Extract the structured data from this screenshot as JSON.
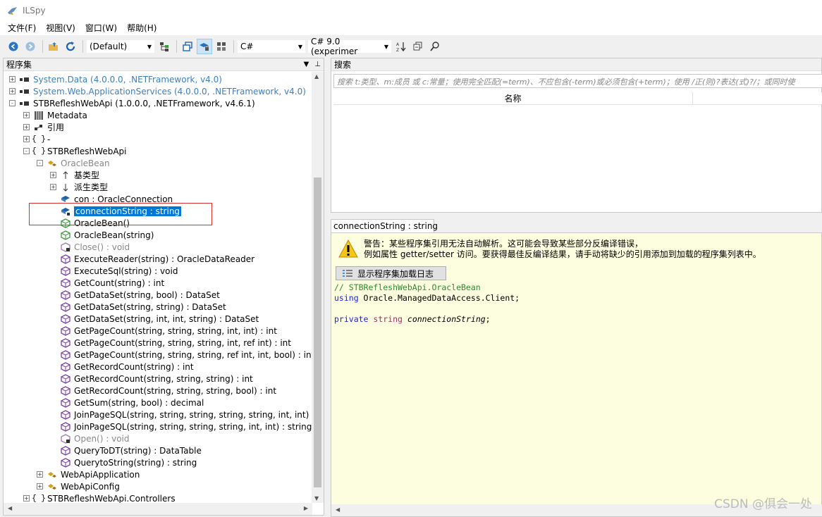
{
  "window": {
    "title": "ILSpy"
  },
  "menu": [
    "文件(F)",
    "视图(V)",
    "窗口(W)",
    "帮助(H)"
  ],
  "toolbar": {
    "assembly_list": "(Default)",
    "language": "C#",
    "language_version": "C# 9.0 (experimer"
  },
  "assembly_panel": {
    "title": "程序集"
  },
  "tree": [
    {
      "label": "System.Data (4.0.0.0, .NETFramework, v4.0)",
      "style": "blue",
      "indent": 0,
      "expander": "+",
      "icon": "assembly-icon"
    },
    {
      "label": "System.Web.ApplicationServices (4.0.0.0, .NETFramework, v4.0)",
      "style": "blue",
      "indent": 0,
      "expander": "+",
      "icon": "assembly-icon"
    },
    {
      "label": "STBRefleshWebApi (1.0.0.0, .NETFramework, v4.6.1)",
      "style": "normal",
      "indent": 0,
      "expander": "-",
      "icon": "assembly-icon"
    },
    {
      "label": "Metadata",
      "style": "normal",
      "indent": 1,
      "expander": "+",
      "icon": "metadata-icon"
    },
    {
      "label": "引用",
      "style": "normal",
      "indent": 1,
      "expander": "+",
      "icon": "references-icon"
    },
    {
      "label": "-",
      "style": "normal",
      "indent": 1,
      "expander": "+",
      "icon": "namespace-icon"
    },
    {
      "label": "STBRefleshWebApi",
      "style": "normal",
      "indent": 1,
      "expander": "-",
      "icon": "namespace-icon"
    },
    {
      "label": "OracleBean",
      "style": "gray",
      "indent": 2,
      "expander": "-",
      "icon": "class-icon"
    },
    {
      "label": "基类型",
      "style": "normal",
      "indent": 3,
      "expander": "+",
      "icon": "base-types-icon"
    },
    {
      "label": "派生类型",
      "style": "normal",
      "indent": 3,
      "expander": "+",
      "icon": "derived-types-icon"
    },
    {
      "label": "con : OracleConnection",
      "style": "normal",
      "indent": 3,
      "expander": "",
      "icon": "field-icon"
    },
    {
      "label": "connectionString : string",
      "style": "selected",
      "indent": 3,
      "expander": "",
      "icon": "field-private-icon"
    },
    {
      "label": "OracleBean()",
      "style": "normal",
      "indent": 3,
      "expander": "",
      "icon": "constructor-icon"
    },
    {
      "label": "OracleBean(string)",
      "style": "normal",
      "indent": 3,
      "expander": "",
      "icon": "constructor-icon"
    },
    {
      "label": "Close() : void",
      "style": "gray",
      "indent": 3,
      "expander": "",
      "icon": "method-private-icon"
    },
    {
      "label": "ExecuteReader(string) : OracleDataReader",
      "style": "normal",
      "indent": 3,
      "expander": "",
      "icon": "method-icon"
    },
    {
      "label": "ExecuteSql(string) : void",
      "style": "normal",
      "indent": 3,
      "expander": "",
      "icon": "method-icon"
    },
    {
      "label": "GetCount(string) : int",
      "style": "normal",
      "indent": 3,
      "expander": "",
      "icon": "method-icon"
    },
    {
      "label": "GetDataSet(string, bool) : DataSet",
      "style": "normal",
      "indent": 3,
      "expander": "",
      "icon": "method-icon"
    },
    {
      "label": "GetDataSet(string, string) : DataSet",
      "style": "normal",
      "indent": 3,
      "expander": "",
      "icon": "method-icon"
    },
    {
      "label": "GetDataSet(string, int, int, string) : DataSet",
      "style": "normal",
      "indent": 3,
      "expander": "",
      "icon": "method-icon"
    },
    {
      "label": "GetPageCount(string, string, string, int, int) : int",
      "style": "normal",
      "indent": 3,
      "expander": "",
      "icon": "method-icon"
    },
    {
      "label": "GetPageCount(string, string, string, int, ref int) : int",
      "style": "normal",
      "indent": 3,
      "expander": "",
      "icon": "method-icon"
    },
    {
      "label": "GetPageCount(string, string, string, ref int, int, bool) : int",
      "style": "normal",
      "indent": 3,
      "expander": "",
      "icon": "method-icon"
    },
    {
      "label": "GetRecordCount(string) : int",
      "style": "normal",
      "indent": 3,
      "expander": "",
      "icon": "method-icon"
    },
    {
      "label": "GetRecordCount(string, string, string) : int",
      "style": "normal",
      "indent": 3,
      "expander": "",
      "icon": "method-icon"
    },
    {
      "label": "GetRecordCount(string, string, string, bool) : int",
      "style": "normal",
      "indent": 3,
      "expander": "",
      "icon": "method-icon"
    },
    {
      "label": "GetSum(string, bool) : decimal",
      "style": "normal",
      "indent": 3,
      "expander": "",
      "icon": "method-icon"
    },
    {
      "label": "JoinPageSQL(string, string, string, string, string, int, int) : s",
      "style": "normal",
      "indent": 3,
      "expander": "",
      "icon": "method-icon"
    },
    {
      "label": "JoinPageSQL(string, string, string, string, int, int) : string",
      "style": "normal",
      "indent": 3,
      "expander": "",
      "icon": "method-icon"
    },
    {
      "label": "Open() : void",
      "style": "gray",
      "indent": 3,
      "expander": "",
      "icon": "method-private-icon"
    },
    {
      "label": "QueryToDT(string) : DataTable",
      "style": "normal",
      "indent": 3,
      "expander": "",
      "icon": "method-icon"
    },
    {
      "label": "QuerytoString(string) : string",
      "style": "normal",
      "indent": 3,
      "expander": "",
      "icon": "method-icon"
    },
    {
      "label": "WebApiApplication",
      "style": "normal",
      "indent": 2,
      "expander": "+",
      "icon": "class-icon"
    },
    {
      "label": "WebApiConfig",
      "style": "normal",
      "indent": 2,
      "expander": "+",
      "icon": "class-icon"
    },
    {
      "label": "STBRefleshWebApi.Controllers",
      "style": "normal",
      "indent": 1,
      "expander": "+",
      "icon": "namespace-icon"
    }
  ],
  "search": {
    "title": "搜索",
    "placeholder": "搜索 t:类型、m:成员 或 c:常量；使用完全匹配(=term)、不应包含(-term)或必须包含(+term)；使用 /正(则)?表达(式)?/；或同时使",
    "column_name": "名称"
  },
  "editor": {
    "tab_label": "connectionString : string",
    "warning_line1": "警告：某些程序集引用无法自动解析。这可能会导致某些部分反编译错误，",
    "warning_line2": "例如属性 getter/setter 访问。要获得最佳反编译结果，请手动将缺少的引用添加到加载的程序集列表中。",
    "log_button": "显示程序集加载日志",
    "code_comment": "// STBRefleshWebApi.OracleBean",
    "code_using_kw": "using",
    "code_using_ns": " Oracle.ManagedDataAccess.Client;",
    "code_private_kw": "private",
    "code_string_type": "string",
    "code_field_name": "connectionString",
    "code_semicolon": ";"
  },
  "watermark": "CSDN @俱会一处"
}
